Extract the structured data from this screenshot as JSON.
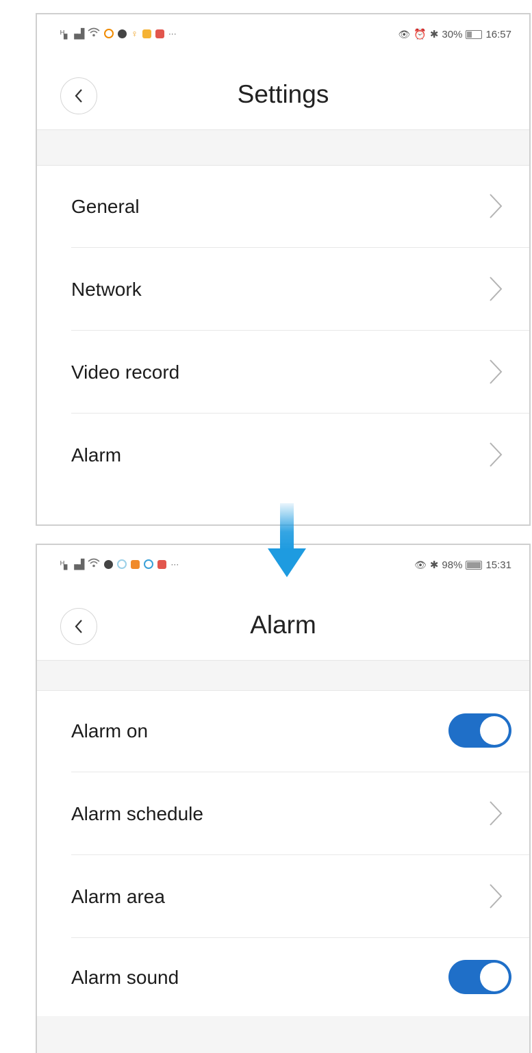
{
  "settings_screen": {
    "status": {
      "battery": "30%",
      "time": "16:57"
    },
    "title": "Settings",
    "items": [
      {
        "label": "General"
      },
      {
        "label": "Network"
      },
      {
        "label": "Video record"
      },
      {
        "label": "Alarm"
      }
    ]
  },
  "alarm_screen": {
    "status": {
      "battery": "98%",
      "time": "15:31"
    },
    "title": "Alarm",
    "items": [
      {
        "label": "Alarm on",
        "control": "toggle",
        "on": true
      },
      {
        "label": "Alarm schedule",
        "control": "chevron"
      },
      {
        "label": "Alarm area",
        "control": "chevron"
      },
      {
        "label": "Alarm sound",
        "control": "toggle",
        "on": true
      }
    ]
  },
  "colors": {
    "toggle_on": "#1f6fc8",
    "arrow": "#1e9be0",
    "divider": "#e8e8e8"
  }
}
